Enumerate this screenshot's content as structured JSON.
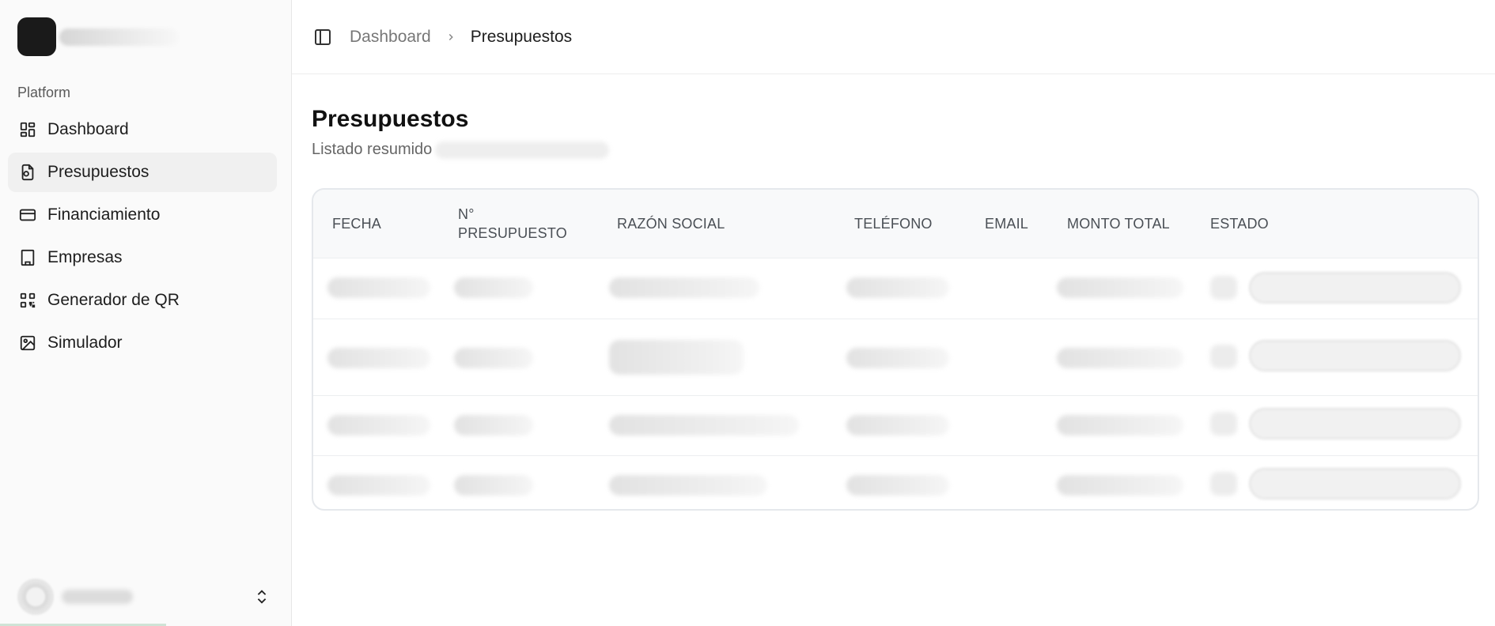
{
  "sidebar": {
    "section_label": "Platform",
    "items": [
      {
        "label": "Dashboard",
        "icon": "grid-icon"
      },
      {
        "label": "Presupuestos",
        "icon": "file-icon",
        "active": true
      },
      {
        "label": "Financiamiento",
        "icon": "credit-card-icon"
      },
      {
        "label": "Empresas",
        "icon": "building-icon"
      },
      {
        "label": "Generador de QR",
        "icon": "qr-code-icon"
      },
      {
        "label": "Simulador",
        "icon": "image-icon"
      }
    ]
  },
  "breadcrumb": {
    "parent": "Dashboard",
    "current": "Presupuestos"
  },
  "page": {
    "title": "Presupuestos",
    "subtitle": "Listado resumido"
  },
  "table": {
    "columns": [
      "FECHA",
      "N°\nPRESUPUESTO",
      "RAZÓN SOCIAL",
      "TELÉFONO",
      "EMAIL",
      "MONTO TOTAL",
      "ESTADO"
    ]
  },
  "colors": {
    "sidebar_bg": "#fafafa",
    "active_item_bg": "#f0f0f0",
    "header_bg": "#f8f9fa"
  }
}
